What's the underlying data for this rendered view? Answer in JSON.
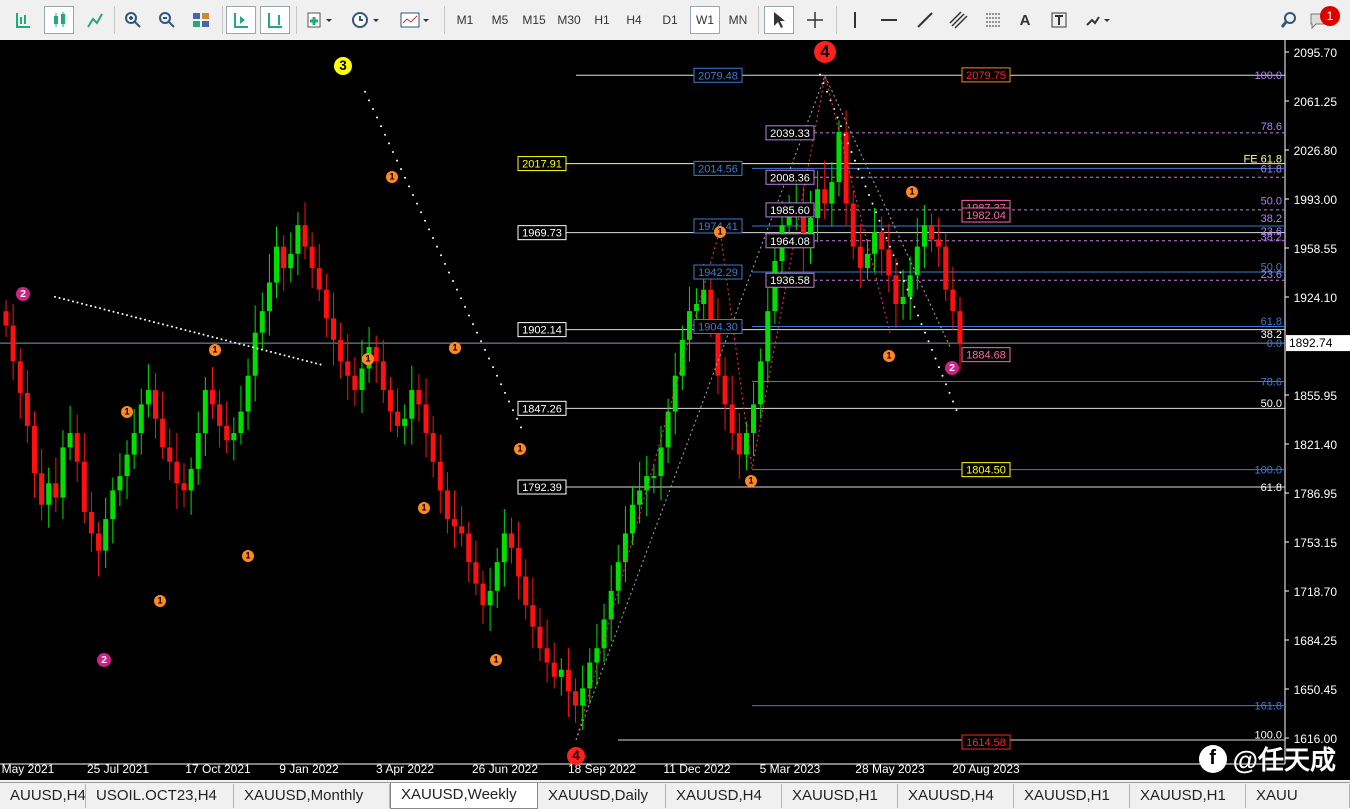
{
  "toolbar": {
    "timeframes": [
      "M1",
      "M5",
      "M15",
      "M30",
      "H1",
      "H4",
      "D1",
      "W1",
      "MN"
    ],
    "active_timeframe": "W1",
    "notification_count": "1",
    "tools": [
      "bar-chart-icon",
      "candlestick-icon",
      "line-chart-icon",
      "zoom-in-icon",
      "zoom-out-icon",
      "tile-windows-icon",
      "autoscroll-icon",
      "chart-shift-icon",
      "new-indicator-icon",
      "periods-clock-icon",
      "templates-icon",
      "cursor-icon",
      "crosshair-icon",
      "vertical-line-icon",
      "horizontal-line-icon",
      "trendline-icon",
      "equidistant-channel-icon",
      "fibonacci-icon",
      "text-icon",
      "text-label-icon",
      "arrows-icon",
      "search-icon",
      "chat-icon"
    ]
  },
  "chart": {
    "symbol_tab": "XAUUSD,Weekly",
    "price_axis": [
      "2095.70",
      "2061.25",
      "2026.80",
      "1993.00",
      "1958.55",
      "1924.10",
      "1890.2",
      "1855.95",
      "1821.40",
      "1786.95",
      "1753.15",
      "1718.70",
      "1684.25",
      "1650.45",
      "1616.00"
    ],
    "current_price": "1892.74",
    "date_axis": [
      "May 2021",
      "25 Jul 2021",
      "17 Oct 2021",
      "9 Jan 2022",
      "3 Apr 2022",
      "26 Jun 2022",
      "18 Sep 2022",
      "11 Dec 2022",
      "5 Mar 2023",
      "28 May 2023",
      "20 Aug 2023"
    ],
    "level_labels_left": [
      "2017.91",
      "1969.73",
      "1902.14",
      "1847.26",
      "1792.39"
    ],
    "fib_boxes_blue": [
      "2079.48",
      "2014.56",
      "1974.41",
      "1942.29",
      "1904.30"
    ],
    "fib_boxes_pink": [
      "2039.33",
      "2008.36",
      "1985.60",
      "1964.08",
      "1936.58"
    ],
    "right_boxes": {
      "top": "2079.75",
      "mid1": "1987.37",
      "mid2": "1982.04",
      "low": "1884.68",
      "support": "1804.50",
      "bottom": "1614.58"
    },
    "fib_percents_right": [
      "100.0",
      "78.6",
      "FE 61.8",
      "61.8",
      "50.0",
      "38.2",
      "23.6",
      "38.2",
      "50.0",
      "23.6",
      "61.8",
      "38.2",
      "0.0",
      "78.6",
      "50.0",
      "100.0",
      "61.8",
      "161.8",
      "100.0"
    ],
    "wave_labels": [
      "3",
      "4",
      "4",
      "2",
      "2",
      "2",
      "1",
      "1",
      "1",
      "1",
      "1",
      "1",
      "1",
      "1",
      "1",
      "1",
      "1",
      "1",
      "1",
      "1",
      "1",
      "1"
    ]
  },
  "tabs": [
    "AUUSD,H4",
    "USOIL.OCT23,H4",
    "XAUUSD,Monthly",
    "XAUUSD,Weekly",
    "XAUUSD,Daily",
    "XAUUSD,H4",
    "XAUUSD,H1",
    "XAUUSD,H4",
    "XAUUSD,H1",
    "XAUUSD,H1",
    "XAUU"
  ],
  "watermark": "@任天成",
  "colors": {
    "bull": "#00e000",
    "bear": "#ff1010",
    "fib_blue": "#3a7bd5",
    "fib_pink": "#c080e0",
    "yellow": "#ffff00"
  }
}
